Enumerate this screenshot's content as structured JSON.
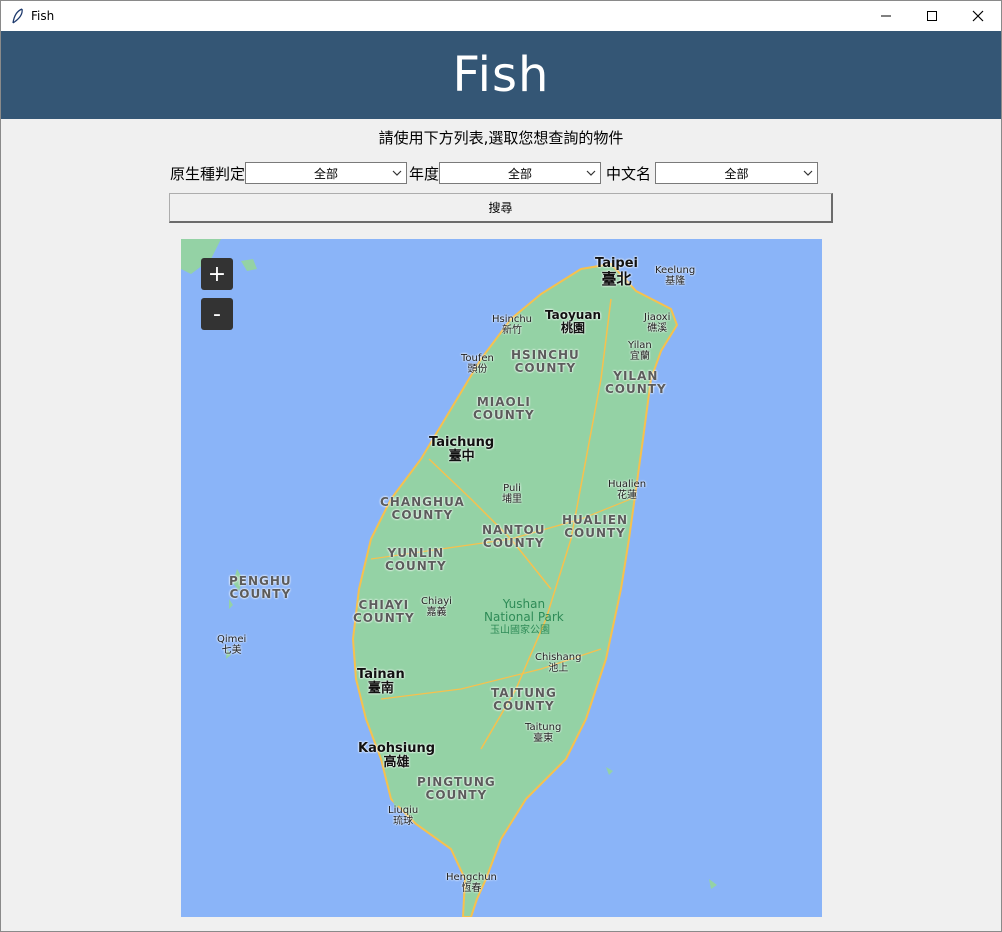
{
  "window": {
    "title": "Fish"
  },
  "header": {
    "title": "Fish"
  },
  "instruction": "請使用下方列表,選取您想查詢的物件",
  "filters": [
    {
      "label": "原生種判定",
      "value": "全部"
    },
    {
      "label": "年度",
      "value": "全部"
    },
    {
      "label": "中文名",
      "value": "全部"
    }
  ],
  "search_button": "搜尋",
  "map": {
    "zoom_in": "+",
    "zoom_out": "-",
    "labels": {
      "taipei_en": "Taipei",
      "taipei_zh": "臺北",
      "keelung_en": "Keelung",
      "keelung_zh": "基隆",
      "taoyuan_en": "Taoyuan",
      "taoyuan_zh": "桃園",
      "hsinchu_en": "Hsinchu",
      "hsinchu_zh": "新竹",
      "jiaoxi_en": "Jiaoxi",
      "jiaoxi_zh": "礁溪",
      "yilan_en": "Yilan",
      "yilan_zh": "宜蘭",
      "toufen_en": "Toufen",
      "toufen_zh": "頭份",
      "hsinchu_county": "HSINCHU\nCOUNTY",
      "yilan_county": "YILAN\nCOUNTY",
      "miaoli_county": "MIAOLI\nCOUNTY",
      "taichung_en": "Taichung",
      "taichung_zh": "臺中",
      "puli_en": "Puli",
      "puli_zh": "埔里",
      "hualien_en": "Hualien",
      "hualien_zh": "花蓮",
      "changhua_county": "CHANGHUA\nCOUNTY",
      "nantou_county": "NANTOU\nCOUNTY",
      "hualien_county": "HUALIEN\nCOUNTY",
      "yunlin_county": "YUNLIN\nCOUNTY",
      "penghu_county": "PENGHU\nCOUNTY",
      "chiayi_county": "CHIAYI\nCOUNTY",
      "chiayi_en": "Chiayi",
      "chiayi_zh": "嘉義",
      "yushan": "Yushan\nNational Park",
      "yushan_zh": "玉山國家公園",
      "qimei_en": "Qimei",
      "qimei_zh": "七美",
      "chishang_en": "Chishang",
      "chishang_zh": "池上",
      "tainan_en": "Tainan",
      "tainan_zh": "臺南",
      "taitung_county": "TAITUNG\nCOUNTY",
      "taitung_en": "Taitung",
      "taitung_zh": "臺東",
      "kaohsiung_en": "Kaohsiung",
      "kaohsiung_zh": "高雄",
      "pingtung_county": "PINGTUNG\nCOUNTY",
      "liuqiu_en": "Liuqiu",
      "liuqiu_zh": "琉球",
      "hengchun_en": "Hengchun",
      "hengchun_zh": "恆春"
    }
  },
  "colors": {
    "header_bg": "#345675",
    "sea": "#8ab4f8",
    "land": "#94d2a5",
    "road": "#f6c14e"
  }
}
